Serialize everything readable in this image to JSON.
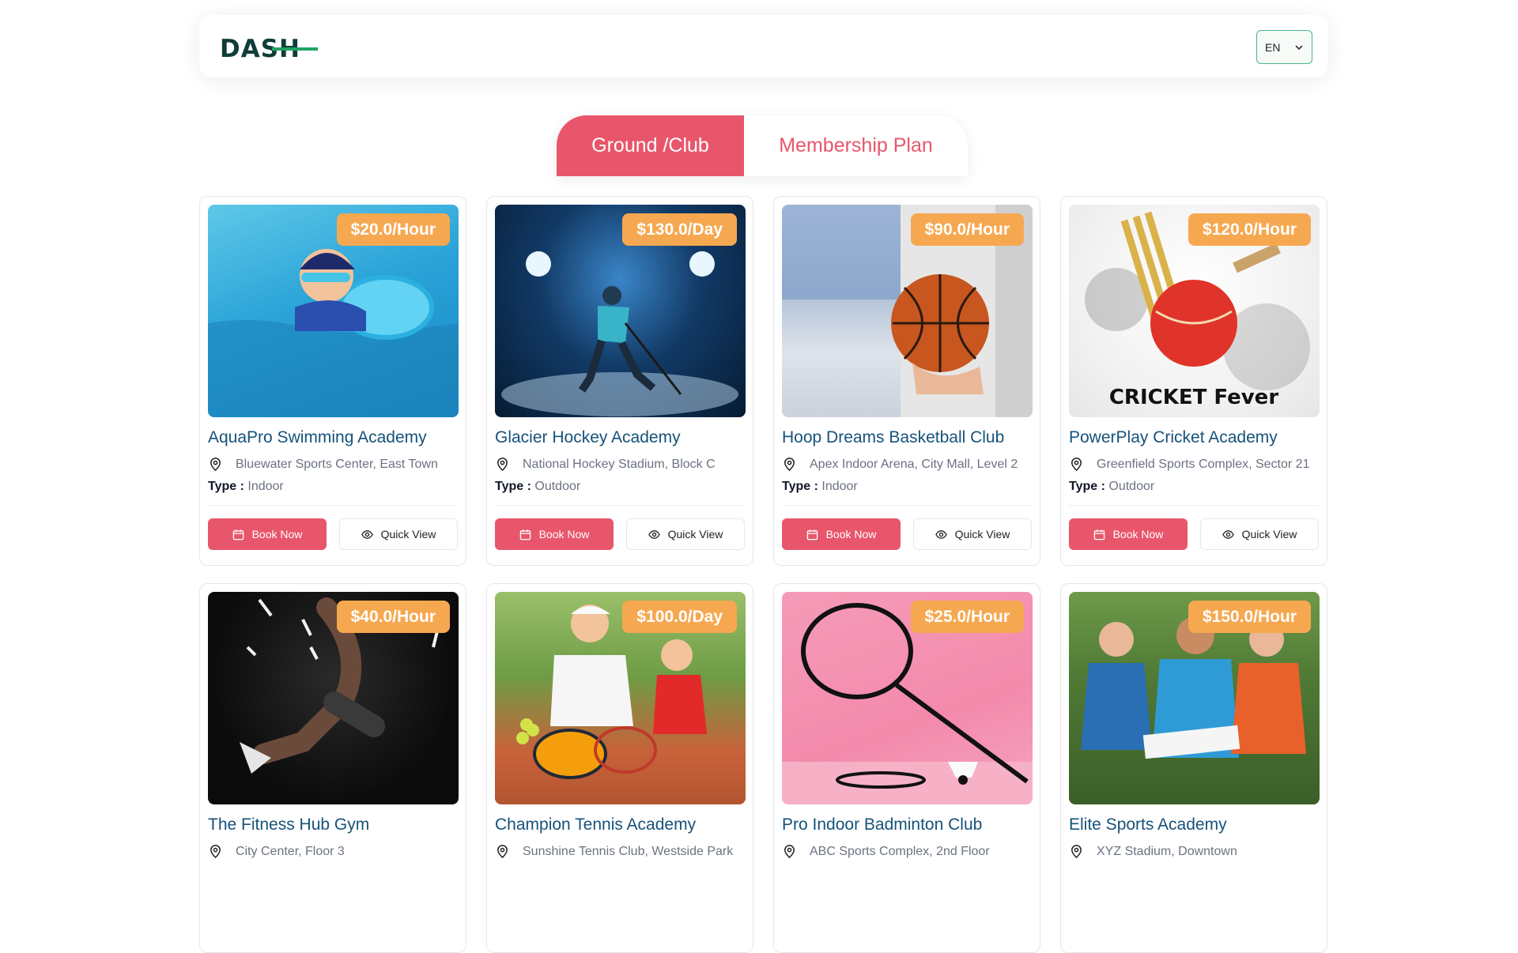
{
  "header": {
    "logo_text": "DASH",
    "language": "EN"
  },
  "tabs": [
    {
      "label": "Ground /Club",
      "active": true
    },
    {
      "label": "Membership Plan",
      "active": false
    }
  ],
  "labels": {
    "type_prefix": "Type :",
    "book": "Book Now",
    "quick_view": "Quick View"
  },
  "cards": [
    {
      "title": "AquaPro Swimming Academy",
      "price": "$20.0/Hour",
      "location": "Bluewater Sports Center, East Town",
      "type": "Indoor"
    },
    {
      "title": "Glacier Hockey Academy",
      "price": "$130.0/Day",
      "location": "National Hockey Stadium, Block C",
      "type": "Outdoor"
    },
    {
      "title": "Hoop Dreams Basketball Club",
      "price": "$90.0/Hour",
      "location": "Apex Indoor Arena, City Mall, Level 2",
      "type": "Indoor"
    },
    {
      "title": "PowerPlay Cricket Academy",
      "price": "$120.0/Hour",
      "location": "Greenfield Sports Complex, Sector 21",
      "type": "Outdoor",
      "image_text": "CRICKET Fever"
    },
    {
      "title": "The Fitness Hub Gym",
      "price": "$40.0/Hour",
      "location": "City Center, Floor 3",
      "type": ""
    },
    {
      "title": "Champion Tennis Academy",
      "price": "$100.0/Day",
      "location": "Sunshine Tennis Club, Westside Park",
      "type": ""
    },
    {
      "title": "Pro Indoor Badminton Club",
      "price": "$25.0/Hour",
      "location": "ABC Sports Complex, 2nd Floor",
      "type": ""
    },
    {
      "title": "Elite Sports Academy",
      "price": "$150.0/Hour",
      "location": "XYZ Stadium, Downtown",
      "type": ""
    }
  ],
  "colors": {
    "primary": "#e8566b",
    "price_badge": "#f6a850",
    "title": "#16527a",
    "logo": "#0f3d3a",
    "logo_accent": "#1fa463"
  }
}
